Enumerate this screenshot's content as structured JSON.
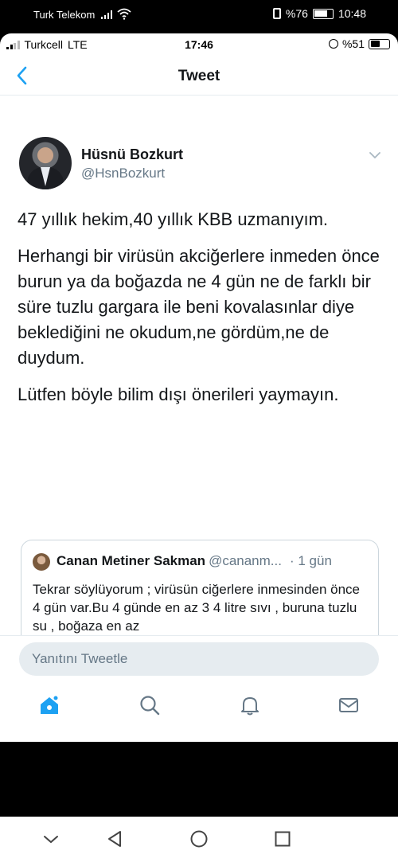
{
  "outer_status": {
    "carrier": "Turk Telekom",
    "battery": "%76",
    "time": "10:48"
  },
  "inner_status": {
    "carrier": "Turkcell",
    "network": "LTE",
    "time": "17:46",
    "battery": "%51"
  },
  "nav": {
    "title": "Tweet"
  },
  "tweet": {
    "author_name": "Hüsnü Bozkurt",
    "author_handle": "@HsnBozkurt",
    "paragraphs": [
      "47 yıllık hekim,40 yıllık KBB uzmanıyım.",
      "Herhangi bir virüsün akciğerlere inmeden önce burun ya da boğazda ne 4 gün ne de farklı bir süre tuzlu gargara ile beni kovalasınlar diye beklediğini ne okudum,ne gördüm,ne de duydum.",
      "Lütfen böyle bilim dışı önerileri yaymayın."
    ]
  },
  "quote": {
    "name": "Canan Metiner Sakman",
    "handle": "@cananm...",
    "time": "· 1 gün",
    "text": "Tekrar söylüyorum ; virüsün ciğerlere inmesinden önce 4 gün var.Bu 4 günde en az 3 4 litre sıvı , buruna tuzlu su , boğaza en az"
  },
  "reply": {
    "placeholder": "Yanıtını Tweetle"
  },
  "colors": {
    "accent": "#1da1f2",
    "secondary_text": "#657786",
    "border": "#e6ecf0"
  },
  "icons": [
    "back-icon",
    "chevron-down-icon",
    "home-icon",
    "search-icon",
    "notifications-icon",
    "messages-icon"
  ]
}
